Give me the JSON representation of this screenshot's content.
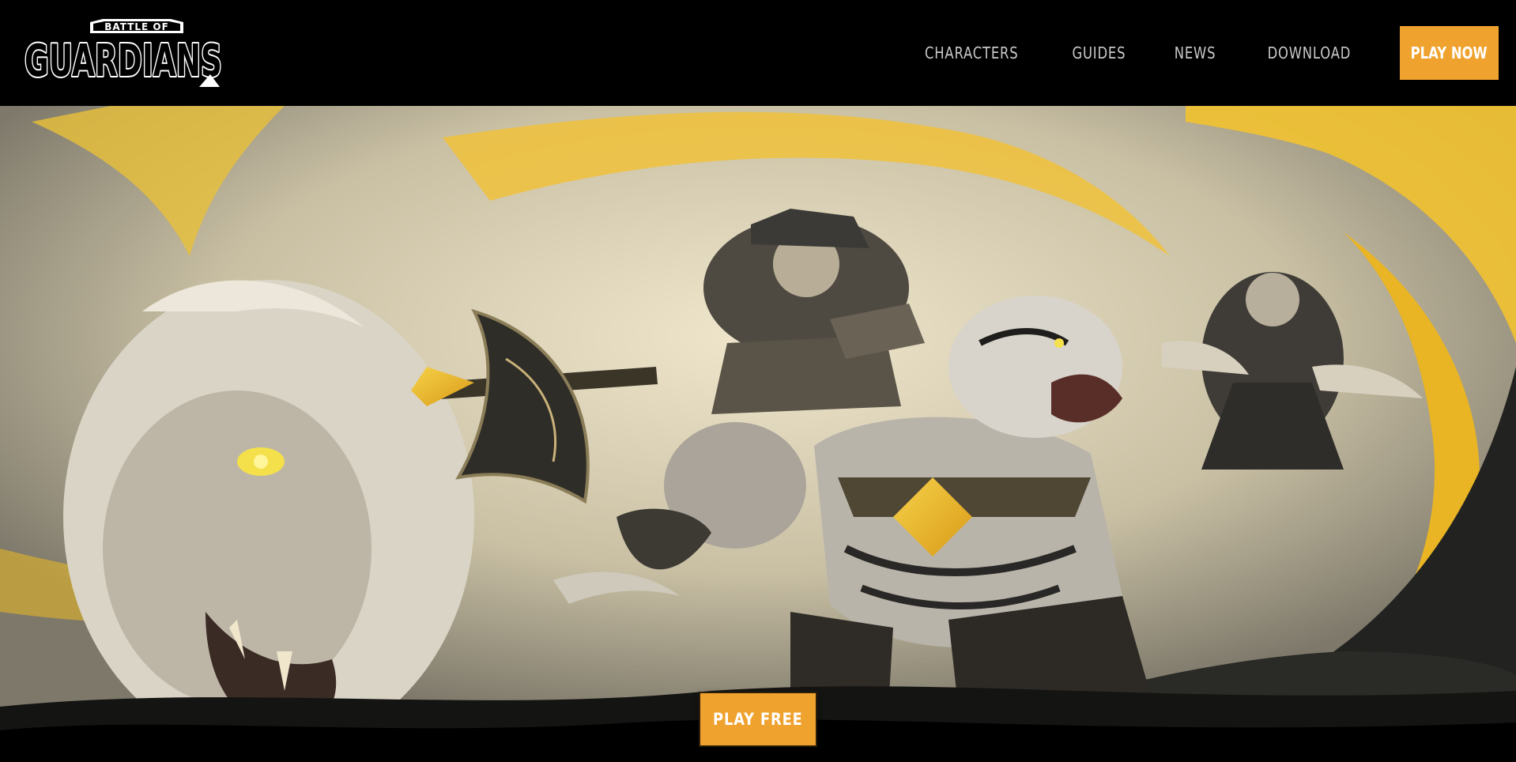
{
  "header": {
    "logo": {
      "line1": "BATTLE OF",
      "line2": "GUARDIANS",
      "icon": "battle-of-guardians-logo"
    },
    "nav": [
      {
        "label": "CHARACTERS"
      },
      {
        "label": "GUIDES"
      },
      {
        "label": "NEWS"
      },
      {
        "label": "DOWNLOAD"
      }
    ],
    "cta_label": "PLAY NOW"
  },
  "hero": {
    "cta_label": "PLAY FREE",
    "artwork": "key-art-guardians"
  },
  "colors": {
    "accent": "#efa22d",
    "header_bg": "#000000",
    "nav_text": "#c9c9c9",
    "brush_yellow": "#f2c230"
  }
}
